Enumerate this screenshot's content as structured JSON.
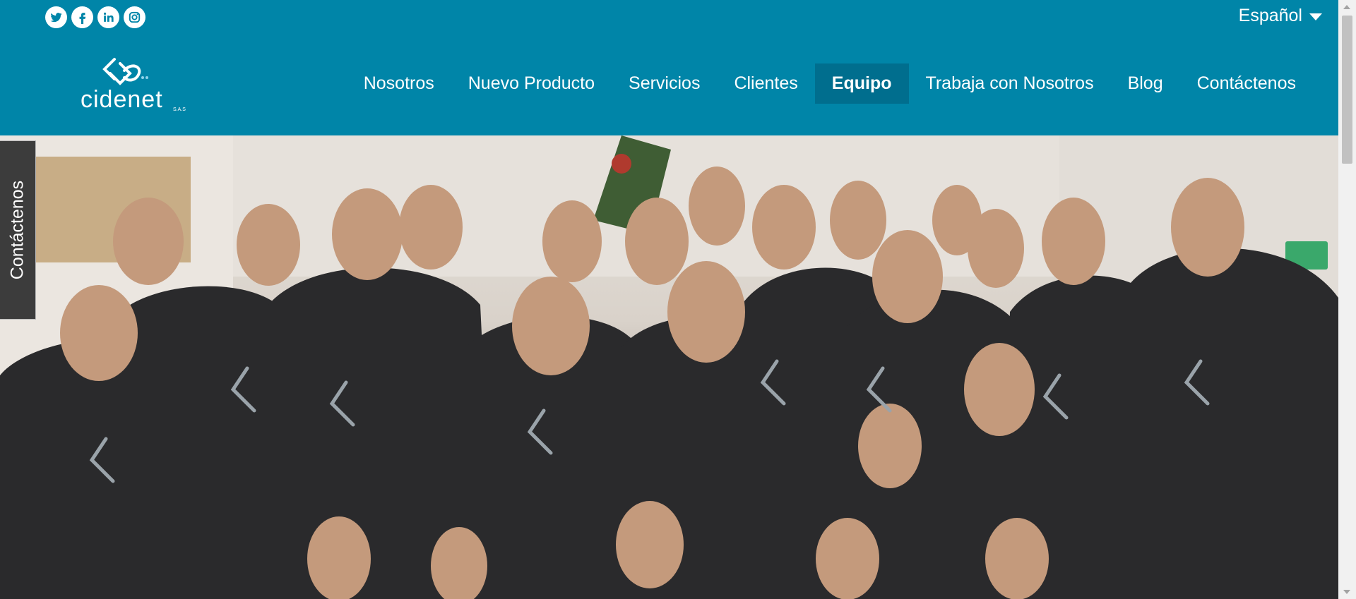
{
  "social": [
    {
      "icon": "twitter-icon"
    },
    {
      "icon": "facebook-icon"
    },
    {
      "icon": "linkedin-icon"
    },
    {
      "icon": "instagram-icon"
    }
  ],
  "language": {
    "label": "Español",
    "icon": "caret-down-icon"
  },
  "logo": {
    "text": "cidenet",
    "suffix": "S.A.S"
  },
  "nav": {
    "items": [
      {
        "label": "Nosotros",
        "active": false
      },
      {
        "label": "Nuevo Producto",
        "active": false
      },
      {
        "label": "Servicios",
        "active": false
      },
      {
        "label": "Clientes",
        "active": false
      },
      {
        "label": "Equipo",
        "active": true
      },
      {
        "label": "Trabaja con Nosotros",
        "active": false
      },
      {
        "label": "Blog",
        "active": false
      },
      {
        "label": "Contáctenos",
        "active": false
      }
    ]
  },
  "side_tab": {
    "label": "Contáctenos"
  },
  "colors": {
    "header": "#0085a8",
    "active_nav": "#006e8e",
    "side_tab": "#3c3c3c"
  }
}
